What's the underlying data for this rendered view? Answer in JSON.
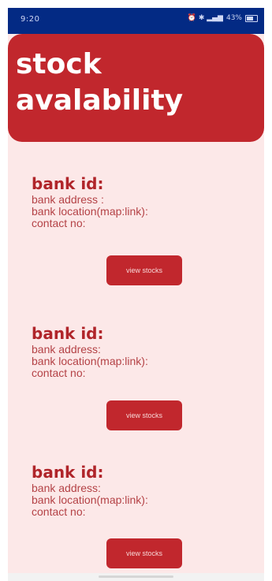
{
  "status_bar": {
    "time": "9:20",
    "icons": [
      "alarm-icon",
      "bluetooth-icon",
      "signal-icon",
      "wifi-icon",
      "battery-icon"
    ],
    "signal_text": "ⓒ ✱ ᴴᴰᴵ",
    "battery_percent_text": "43%"
  },
  "header": {
    "title": "stock\navalability",
    "bg_color": "#c1272d"
  },
  "banks": [
    {
      "id_label": "bank id:",
      "address_label": "bank address :",
      "location_label": "bank location(map:link):",
      "contact_label": "contact no:",
      "button_label": "view stocks"
    },
    {
      "id_label": "bank id:",
      "address_label": "bank address:",
      "location_label": "bank location(map:link):",
      "contact_label": "contact no:",
      "button_label": "view stocks"
    },
    {
      "id_label": "bank id:",
      "address_label": "bank address:",
      "location_label": "bank location(map:link):",
      "contact_label": "contact no:",
      "button_label": "view stocks"
    }
  ],
  "colors": {
    "status_bar": "#032a84",
    "background": "#fce8e8",
    "accent": "#c1272d"
  }
}
